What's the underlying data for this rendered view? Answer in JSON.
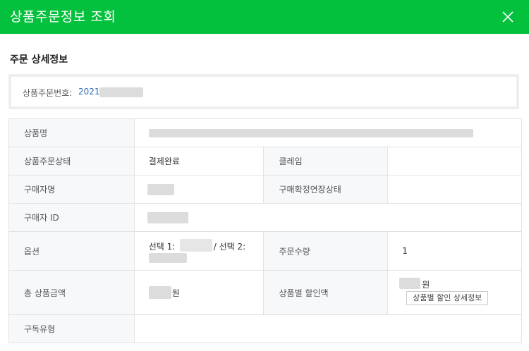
{
  "header": {
    "title": "상품주문정보 조회"
  },
  "section": {
    "title": "주문 상세정보"
  },
  "order": {
    "label": "상품주문번호:",
    "number": "2021"
  },
  "rows": {
    "product_name": {
      "label": "상품명"
    },
    "order_status": {
      "label": "상품주문상태",
      "value": "결제완료",
      "claim_label": "클레임"
    },
    "buyer_name": {
      "label": "구매자명",
      "confirm_label": "구매확정연장상태"
    },
    "buyer_id": {
      "label": "구매자 ID"
    },
    "option": {
      "label": "옵션",
      "text1": "선택 1:",
      "text2": "/ 선택 2:",
      "qty_label": "주문수량",
      "qty": "1"
    },
    "total": {
      "label": "총 상품금액",
      "unit": "원",
      "discount_label": "상품별 할인액",
      "discount_unit": "원",
      "discount_button": "상품별 할인 상세정보"
    },
    "subscription": {
      "label": "구독유형"
    }
  }
}
